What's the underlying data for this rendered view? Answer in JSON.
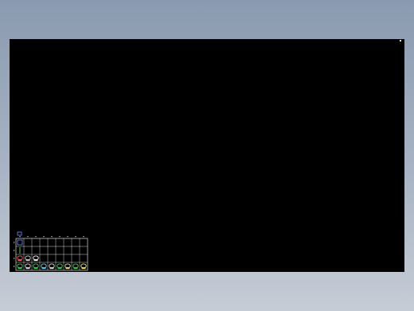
{
  "app": {
    "background_gradient": [
      "#8a9ab0",
      "#c6ccd6"
    ],
    "canvas_background": "#000000",
    "line_color": "#ffffff"
  },
  "table": {
    "columns": 9,
    "rows": 4,
    "column_header_ticks": true,
    "row_header_ticks": true
  },
  "symbols": [
    {
      "row": 0,
      "col": 0,
      "icon": "header-symbol-icon",
      "color": "#6a8cff"
    },
    {
      "row": 1,
      "col": 0,
      "icon": "connector-symbol-icon",
      "color": "#39d353"
    },
    {
      "row": 2,
      "col": 0,
      "icon": "part-symbol-icon",
      "color": "#ff5a5a"
    },
    {
      "row": 2,
      "col": 1,
      "icon": "part-symbol-icon",
      "color": "#d0d0d0"
    },
    {
      "row": 2,
      "col": 2,
      "icon": "part-symbol-icon",
      "color": "#ffffff"
    },
    {
      "row": 3,
      "col": 0,
      "icon": "part-symbol-icon",
      "color": "#39d353"
    },
    {
      "row": 3,
      "col": 1,
      "icon": "part-symbol-icon",
      "color": "#e0e0e0"
    },
    {
      "row": 3,
      "col": 2,
      "icon": "part-symbol-icon",
      "color": "#39d353"
    },
    {
      "row": 3,
      "col": 3,
      "icon": "part-symbol-icon",
      "color": "#5fd3ff"
    },
    {
      "row": 3,
      "col": 4,
      "icon": "part-symbol-icon",
      "color": "#e0e0e0"
    },
    {
      "row": 3,
      "col": 5,
      "icon": "part-symbol-icon",
      "color": "#39d353"
    },
    {
      "row": 3,
      "col": 6,
      "icon": "part-symbol-icon",
      "color": "#e8e8a0"
    },
    {
      "row": 3,
      "col": 7,
      "icon": "part-symbol-icon",
      "color": "#39d353"
    },
    {
      "row": 3,
      "col": 8,
      "icon": "part-symbol-icon",
      "color": "#f0f060"
    }
  ]
}
